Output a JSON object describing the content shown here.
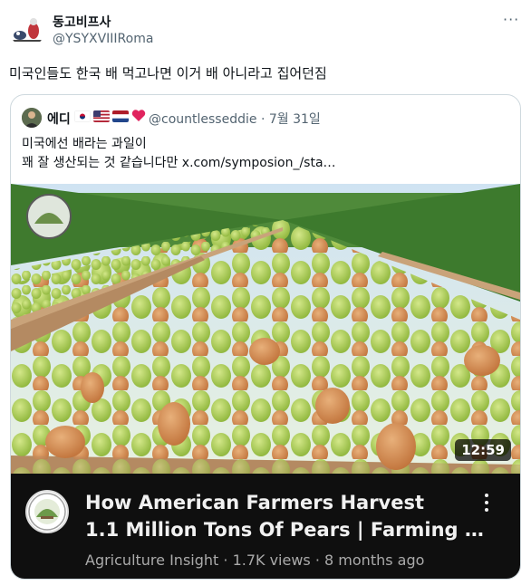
{
  "tweet": {
    "display_name": "동고비프사",
    "handle": "@YSYXVIIIRoma",
    "text": "미국인들도 한국 배 먹고나면 이거 배 아니라고 집어던짐",
    "more_icon": "more-horizontal-icon"
  },
  "quote": {
    "display_name": "에디",
    "flags": [
      "south-korea-flag",
      "usa-flag",
      "netherlands-flag",
      "heart-icon"
    ],
    "handle": "@countlesseddie",
    "date": "· 7월 31일",
    "text_line1": "미국에선 배라는 과일이",
    "text_line2": "꽤 잘 생산되는 것 같습니다만  x.com/symposion_/sta…"
  },
  "video": {
    "duration": "12:59",
    "title_line1": "How American Farmers Harvest",
    "title_line2": "1.1 Million Tons Of Pears | Farming …",
    "channel": "Agriculture Insight",
    "views": "1.7K views",
    "age": "8 months ago",
    "meta_sep": " · ",
    "colors": {
      "pear_green": "#9cc43f",
      "pear_blush": "#d98a4a",
      "bar_bg": "#0f0f0f"
    }
  }
}
